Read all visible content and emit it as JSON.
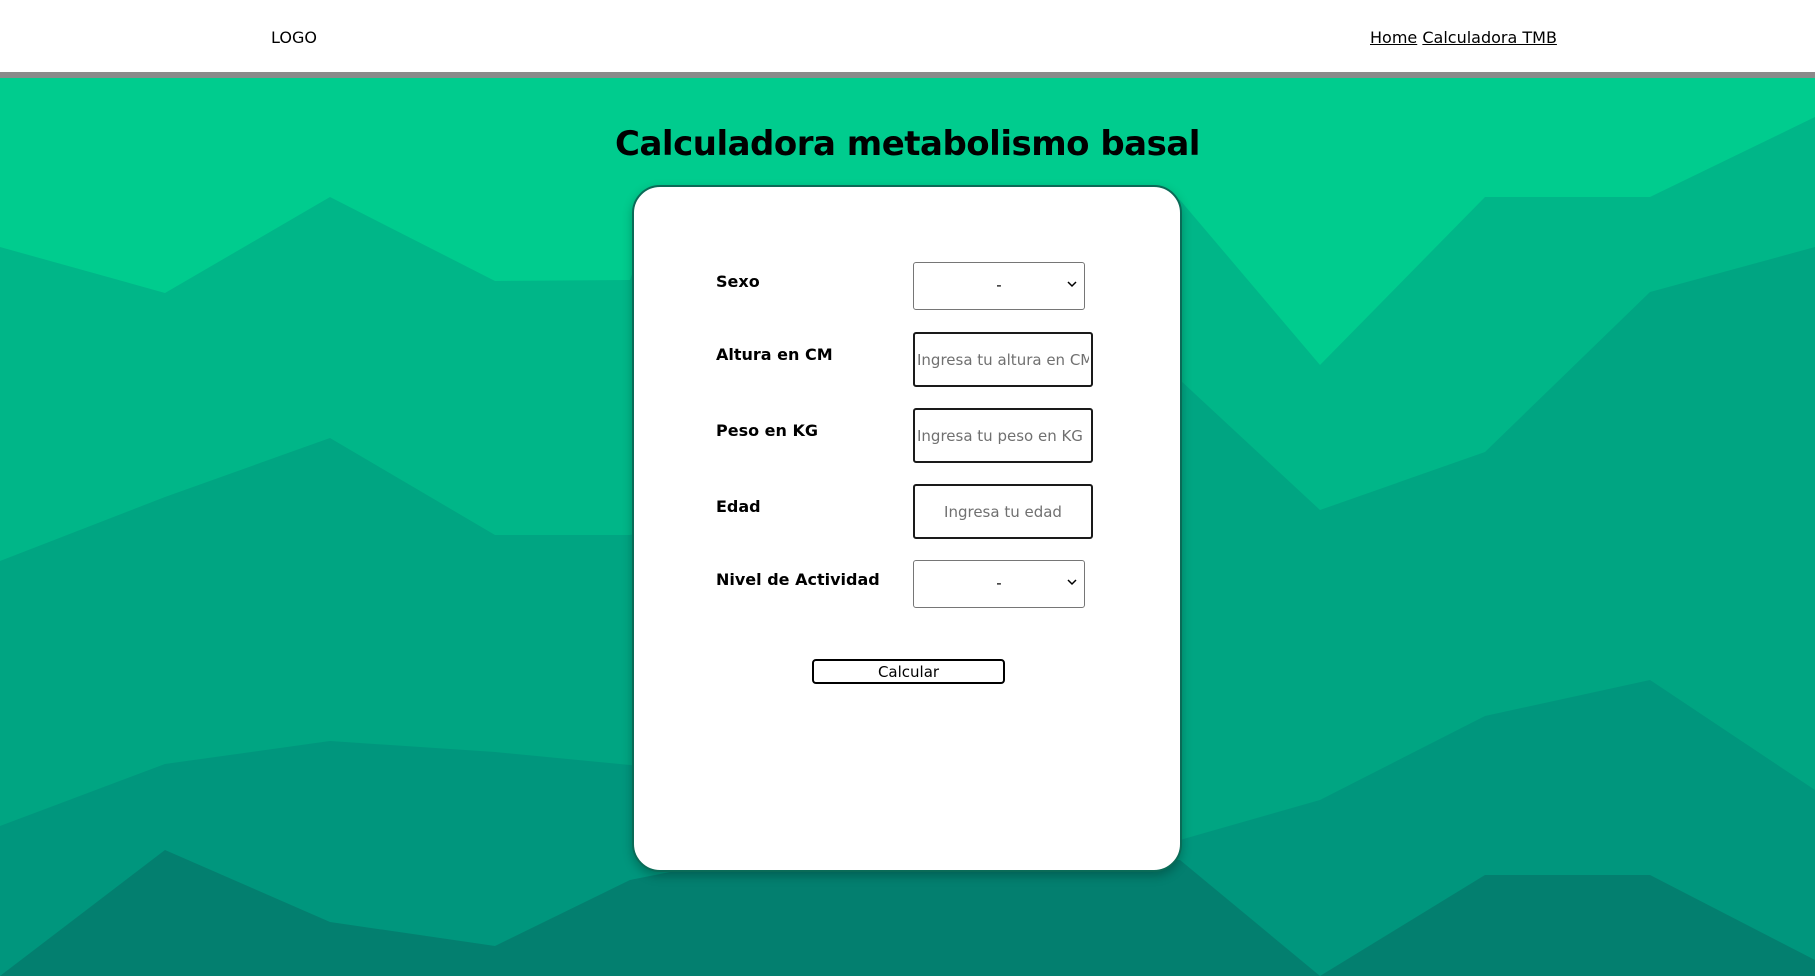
{
  "header": {
    "logo": "LOGO",
    "nav": [
      {
        "label": "Home"
      },
      {
        "label": "Calculadora TMB"
      }
    ]
  },
  "main": {
    "title": "Calculadora metabolismo basal"
  },
  "form": {
    "sexo": {
      "label": "Sexo",
      "selected": "-"
    },
    "altura": {
      "label": "Altura en CM",
      "placeholder": "Ingresa tu altura en CM"
    },
    "peso": {
      "label": "Peso en KG",
      "placeholder": "Ingresa tu peso en KG"
    },
    "edad": {
      "label": "Edad",
      "placeholder": "Ingresa tu edad"
    },
    "actividad": {
      "label": "Nivel de Actividad",
      "selected": "-"
    },
    "submit_label": "Calcular"
  },
  "colors": {
    "header_bg": "#ffffff",
    "header_border": "#8a8a8a",
    "bg_layer_1": "#00cc8e",
    "bg_layer_2": "#00b688",
    "bg_layer_3": "#00a582",
    "bg_layer_4": "#00967d",
    "bg_layer_5": "#037f6f",
    "card_bg": "#ffffff"
  }
}
